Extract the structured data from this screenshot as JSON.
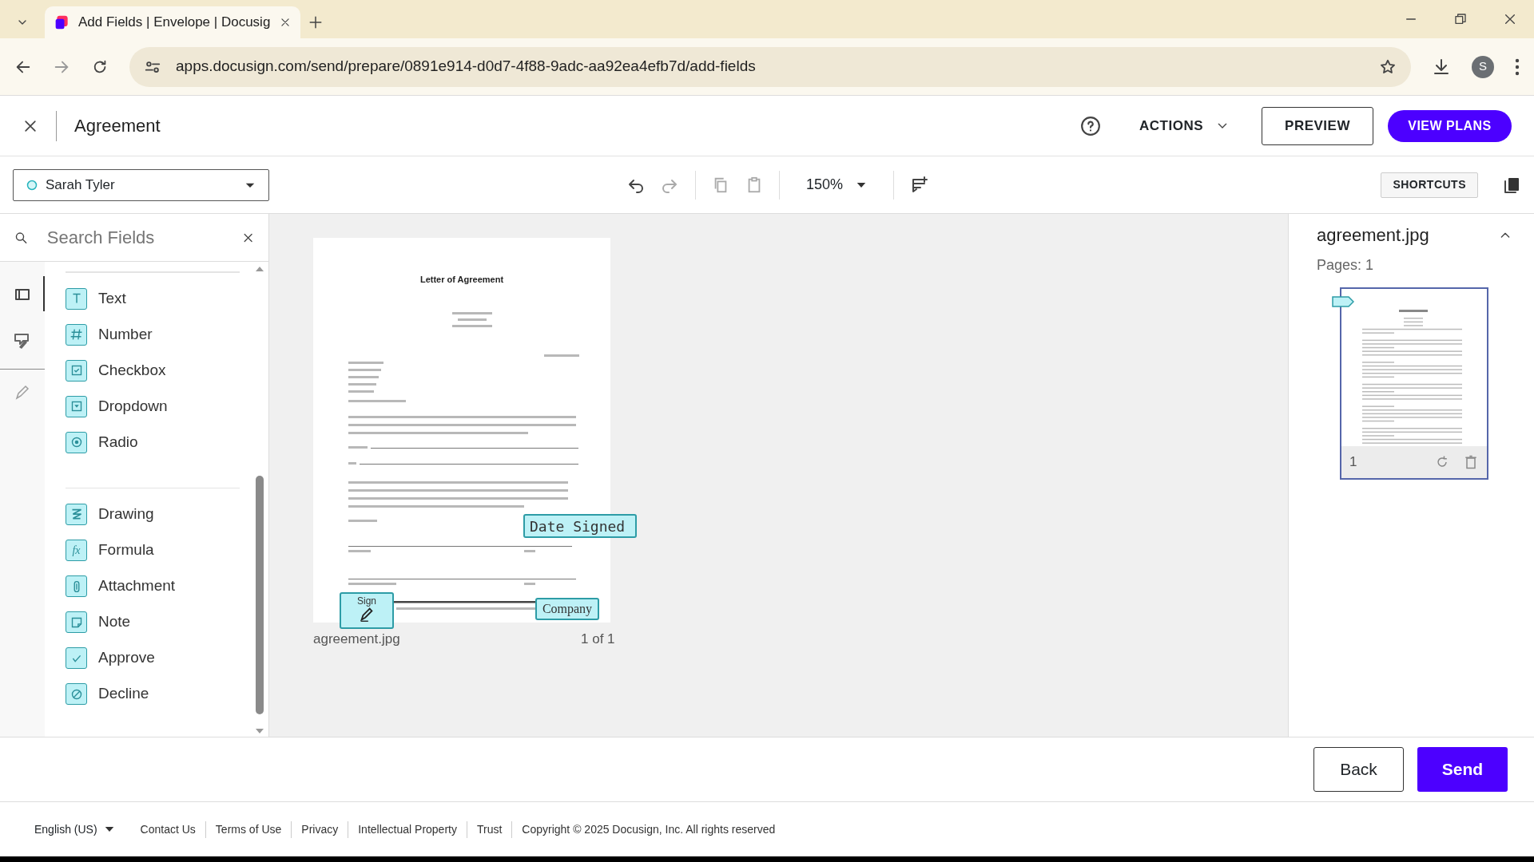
{
  "browser": {
    "tab_title": "Add Fields | Envelope | Docusig",
    "url": "apps.docusign.com/send/prepare/0891e914-d0d7-4f88-9adc-aa92ea4efb7d/add-fields",
    "profile_initial": "S"
  },
  "header": {
    "title": "Agreement",
    "actions": "ACTIONS",
    "preview": "PREVIEW",
    "view_plans": "VIEW PLANS"
  },
  "toolbar": {
    "recipient": "Sarah Tyler",
    "zoom": "150%",
    "shortcuts": "SHORTCUTS"
  },
  "search": {
    "placeholder": "Search Fields"
  },
  "rail": [
    {
      "kind": "fields",
      "selected": true
    },
    {
      "kind": "tools",
      "selected": false
    },
    {
      "kind": "pen",
      "selected": false
    }
  ],
  "field_groups": [
    [
      {
        "label": "Text",
        "kind": "text"
      },
      {
        "label": "Number",
        "kind": "number"
      },
      {
        "label": "Checkbox",
        "kind": "checkbox"
      },
      {
        "label": "Dropdown",
        "kind": "dropdown"
      },
      {
        "label": "Radio",
        "kind": "radio"
      }
    ],
    [
      {
        "label": "Drawing",
        "kind": "drawing"
      },
      {
        "label": "Formula",
        "kind": "formula",
        "icon_text": "fx"
      },
      {
        "label": "Attachment",
        "kind": "attachment"
      },
      {
        "label": "Note",
        "kind": "note"
      },
      {
        "label": "Approve",
        "kind": "approve"
      },
      {
        "label": "Decline",
        "kind": "decline"
      }
    ]
  ],
  "document": {
    "title": "Letter of Agreement",
    "filename": "agreement.jpg",
    "page_count": "1 of 1",
    "tags": [
      {
        "label": "Date Signed",
        "kind": "date"
      },
      {
        "label": "Sign",
        "kind": "signature"
      },
      {
        "label": "Company",
        "kind": "company"
      }
    ]
  },
  "pages_panel": {
    "filename": "agreement.jpg",
    "pages": "Pages: 1",
    "page_number": "1"
  },
  "buttons": {
    "back": "Back",
    "send": "Send"
  },
  "footer": {
    "language": "English (US)",
    "links": [
      "Contact Us",
      "Terms of Use",
      "Privacy",
      "Intellectual Property",
      "Trust"
    ],
    "copyright": "Copyright © 2025 Docusign, Inc. All rights reserved"
  }
}
